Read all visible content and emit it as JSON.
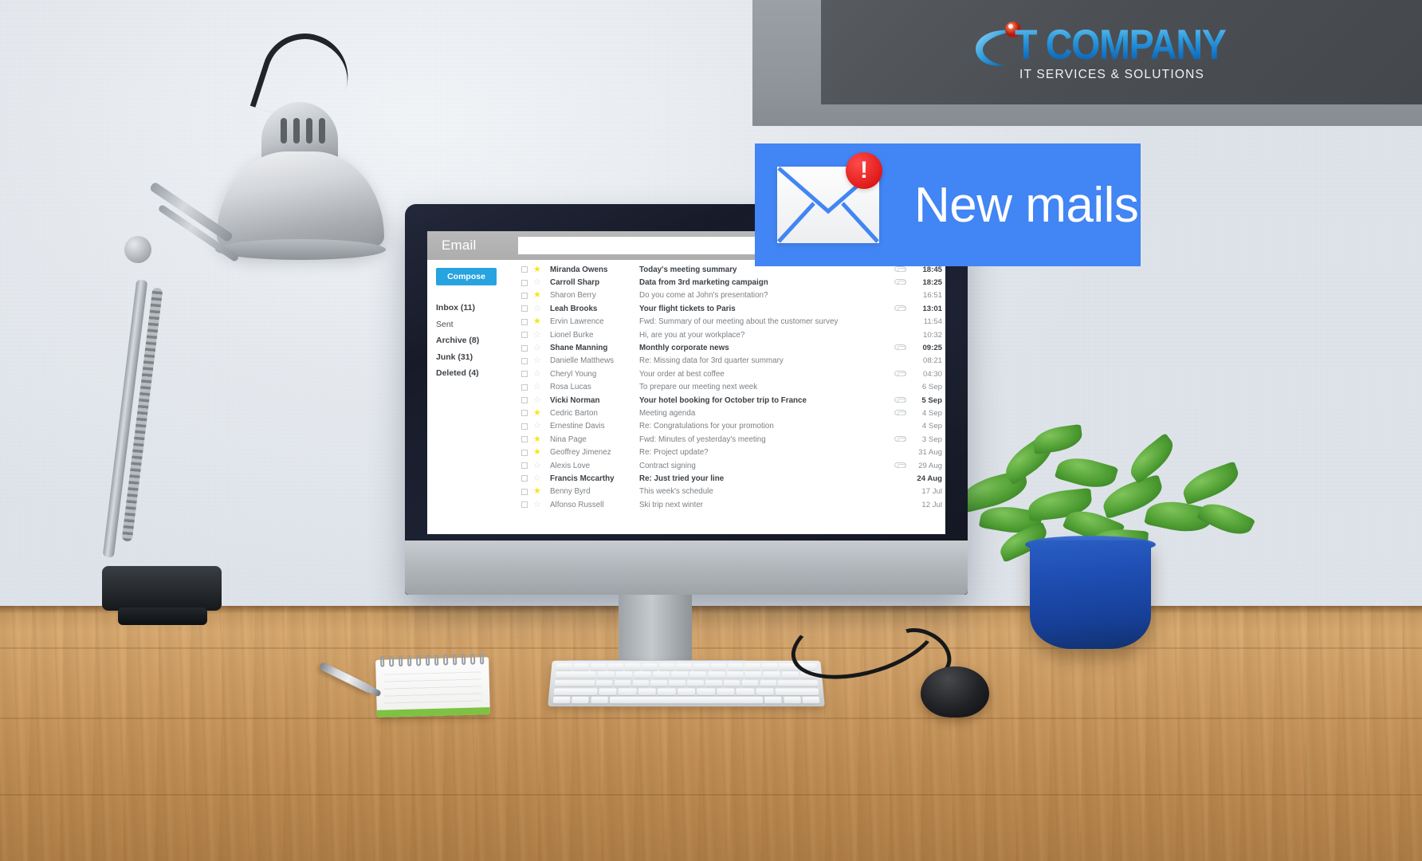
{
  "scene": {
    "description": "Office desk with monitor showing email client"
  },
  "corporate_panel": {
    "logo_text": "T COMPANY",
    "logo_tagline": "IT SERVICES & SOLUTIONS",
    "panel_color": "#4b4f53",
    "logo_blue": "#1e8fd5"
  },
  "notification_banner": {
    "label": "New mails",
    "badge": "!",
    "background_color": "#4285f4",
    "badge_color": "#e01b1b"
  },
  "email_app": {
    "title": "Email",
    "search": {
      "value": "",
      "placeholder": ""
    },
    "search_button_icon": "search-icon",
    "dropdown_icon": "chevron-down-icon",
    "settings_icon": "gear-icon",
    "compose_label": "Compose",
    "compose_color": "#27a3df",
    "folders": [
      {
        "label": "Inbox (11)",
        "bold": true
      },
      {
        "label": "Sent",
        "bold": false
      },
      {
        "label": "Archive (8)",
        "bold": true
      },
      {
        "label": "Junk (31)",
        "bold": true
      },
      {
        "label": "Deleted (4)",
        "bold": true
      }
    ],
    "messages": [
      {
        "sender": "Miranda Owens",
        "subject": "Today's meeting summary",
        "time": "18:45",
        "unread": true,
        "starred": true,
        "attachment": true
      },
      {
        "sender": "Carroll Sharp",
        "subject": "Data from 3rd marketing campaign",
        "time": "18:25",
        "unread": true,
        "starred": false,
        "attachment": true
      },
      {
        "sender": "Sharon Berry",
        "subject": "Do you come at John's presentation?",
        "time": "16:51",
        "unread": false,
        "starred": true,
        "attachment": false
      },
      {
        "sender": "Leah Brooks",
        "subject": "Your flight tickets to Paris",
        "time": "13:01",
        "unread": true,
        "starred": false,
        "attachment": true
      },
      {
        "sender": "Ervin Lawrence",
        "subject": "Fwd: Summary of our meeting about the customer survey",
        "time": "11:54",
        "unread": false,
        "starred": true,
        "attachment": false
      },
      {
        "sender": "Lionel Burke",
        "subject": "Hi, are you at your workplace?",
        "time": "10:32",
        "unread": false,
        "starred": false,
        "attachment": false
      },
      {
        "sender": "Shane Manning",
        "subject": "Monthly corporate news",
        "time": "09:25",
        "unread": true,
        "starred": false,
        "attachment": true
      },
      {
        "sender": "Danielle Matthews",
        "subject": "Re: Missing data for 3rd quarter summary",
        "time": "08:21",
        "unread": false,
        "starred": false,
        "attachment": false
      },
      {
        "sender": "Cheryl Young",
        "subject": "Your order at best coffee",
        "time": "04:30",
        "unread": false,
        "starred": false,
        "attachment": true
      },
      {
        "sender": "Rosa Lucas",
        "subject": "To prepare our meeting next week",
        "time": "6 Sep",
        "unread": false,
        "starred": false,
        "attachment": false
      },
      {
        "sender": "Vicki Norman",
        "subject": "Your hotel booking for October trip to France",
        "time": "5 Sep",
        "unread": true,
        "starred": false,
        "attachment": true
      },
      {
        "sender": "Cedric Barton",
        "subject": "Meeting agenda",
        "time": "4 Sep",
        "unread": false,
        "starred": true,
        "attachment": true
      },
      {
        "sender": "Ernestine Davis",
        "subject": "Re: Congratulations for your promotion",
        "time": "4 Sep",
        "unread": false,
        "starred": false,
        "attachment": false
      },
      {
        "sender": "Nina Page",
        "subject": "Fwd: Minutes of yesterday's meeting",
        "time": "3 Sep",
        "unread": false,
        "starred": true,
        "attachment": true
      },
      {
        "sender": "Geoffrey Jimenez",
        "subject": "Re: Project update?",
        "time": "31 Aug",
        "unread": false,
        "starred": true,
        "attachment": false
      },
      {
        "sender": "Alexis Love",
        "subject": "Contract signing",
        "time": "29 Aug",
        "unread": false,
        "starred": false,
        "attachment": true
      },
      {
        "sender": "Francis Mccarthy",
        "subject": "Re: Just tried your line",
        "time": "24 Aug",
        "unread": true,
        "starred": false,
        "attachment": false
      },
      {
        "sender": "Benny Byrd",
        "subject": "This week's schedule",
        "time": "17 Jul",
        "unread": false,
        "starred": true,
        "attachment": false
      },
      {
        "sender": "Alfonso Russell",
        "subject": "Ski trip next winter",
        "time": "12 Jul",
        "unread": false,
        "starred": false,
        "attachment": false
      }
    ]
  }
}
